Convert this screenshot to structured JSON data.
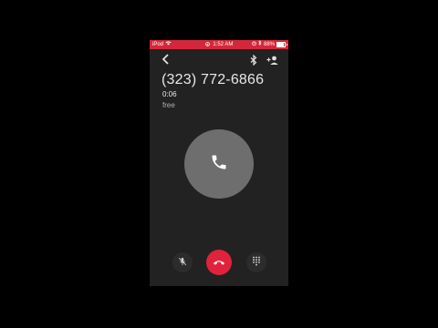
{
  "statusbar": {
    "device": "iPod",
    "time": "1:52 AM",
    "battery_pct": "88%",
    "battery_level": 0.88,
    "bg_color": "#d5273b"
  },
  "call": {
    "number": "(323) 772-6866",
    "duration": "0:06",
    "status": "free"
  },
  "icons": {
    "back": "chevron-left-icon",
    "bluetooth": "bluetooth-icon",
    "add_person": "add-person-icon",
    "phone": "phone-icon",
    "mute": "mic-off-icon",
    "end": "hang-up-icon",
    "dialpad": "dialpad-icon"
  },
  "colors": {
    "screen_bg": "#222222",
    "end_call": "#e0223d",
    "call_circle": "#6e6e6e"
  }
}
